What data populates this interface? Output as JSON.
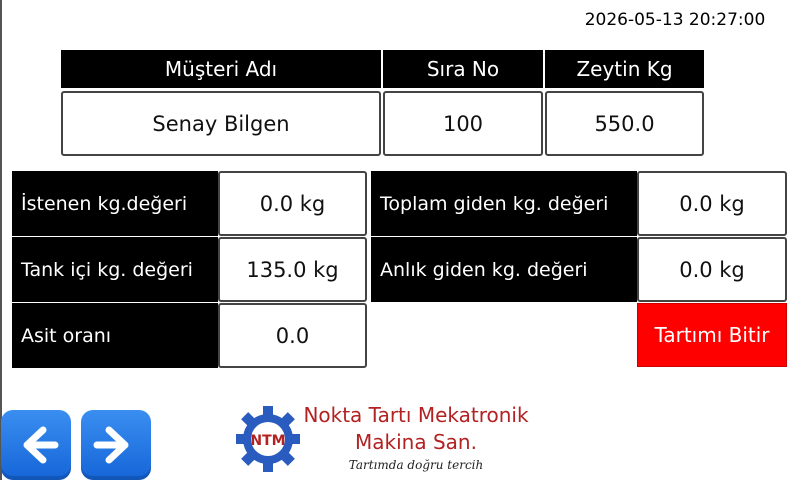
{
  "datetime": "2026-05-13 20:27:00",
  "headers": {
    "customer": "Müşteri Adı",
    "order_no": "Sıra No",
    "olive_kg": "Zeytin Kg"
  },
  "values": {
    "customer": "Senay Bilgen",
    "order_no": "100",
    "olive_kg": "550.0"
  },
  "fields": {
    "requested_label": "İstenen kg.değeri",
    "requested_value": "0.0 kg",
    "tank_label": "Tank içi kg. değeri",
    "tank_value": "135.0 kg",
    "acid_label": "Asit oranı",
    "acid_value": "0.0",
    "total_out_label": "Toplam giden kg. değeri",
    "total_out_value": "0.0 kg",
    "instant_out_label": "Anlık giden kg. değeri",
    "instant_out_value": "0.0 kg"
  },
  "finish_button": "Tartımı Bitir",
  "nav": {
    "back_icon": "arrow-left-icon",
    "forward_icon": "arrow-right-icon"
  },
  "logo": {
    "mark": "NTM",
    "line1": "Nokta Tartı Mekatronik",
    "line2": "Makina San.",
    "tagline": "Tartımda doğru tercih"
  },
  "colors": {
    "finish_button": "#ff0000",
    "nav_button": "#1e74e6",
    "logo_red": "#b22222",
    "logo_gear": "#2a5bbf"
  }
}
